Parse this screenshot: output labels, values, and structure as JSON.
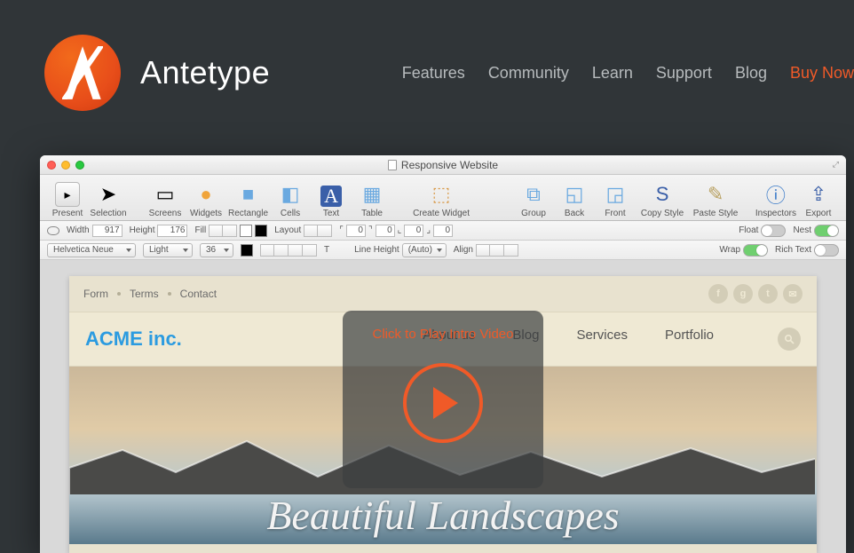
{
  "brand": "Antetype",
  "nav": {
    "features": "Features",
    "community": "Community",
    "learn": "Learn",
    "support": "Support",
    "blog": "Blog",
    "buy": "Buy Now"
  },
  "window": {
    "title": "Responsive Website"
  },
  "toolbar": {
    "present": "Present",
    "selection": "Selection",
    "screens": "Screens",
    "widgets": "Widgets",
    "rectangle": "Rectangle",
    "cells": "Cells",
    "text": "Text",
    "table": "Table",
    "create_widget": "Create Widget",
    "group": "Group",
    "back": "Back",
    "front": "Front",
    "copy_style": "Copy Style",
    "paste_style": "Paste Style",
    "inspectors": "Inspectors",
    "export": "Export"
  },
  "format_bar": {
    "width_label": "Width",
    "width_value": "917",
    "height_label": "Height",
    "height_value": "176",
    "fill_label": "Fill",
    "layout_label": "Layout",
    "float_label": "Float",
    "nest_label": "Nest",
    "padding_top": "0",
    "padding_right": "0",
    "padding_bottom": "0",
    "padding_left": "0"
  },
  "text_bar": {
    "font": "Helvetica Neue",
    "weight": "Light",
    "size": "36",
    "line_height_label": "Line Height",
    "line_height_value": "(Auto)",
    "align_label": "Align",
    "wrap_label": "Wrap",
    "rich_label": "Rich Text"
  },
  "mock": {
    "crumbs": {
      "form": "Form",
      "terms": "Terms",
      "contact": "Contact"
    },
    "brand": "ACME inc.",
    "nav": {
      "about": "About us",
      "blog": "Blog",
      "services": "Services",
      "portfolio": "Portfolio"
    },
    "hero_text": "Beautiful Landscapes",
    "social": {
      "f": "f",
      "g": "g",
      "t": "t",
      "m": "✉"
    }
  },
  "overlay": {
    "text": "Click to Play Intro Video"
  },
  "colors": {
    "accent": "#f05a28"
  }
}
